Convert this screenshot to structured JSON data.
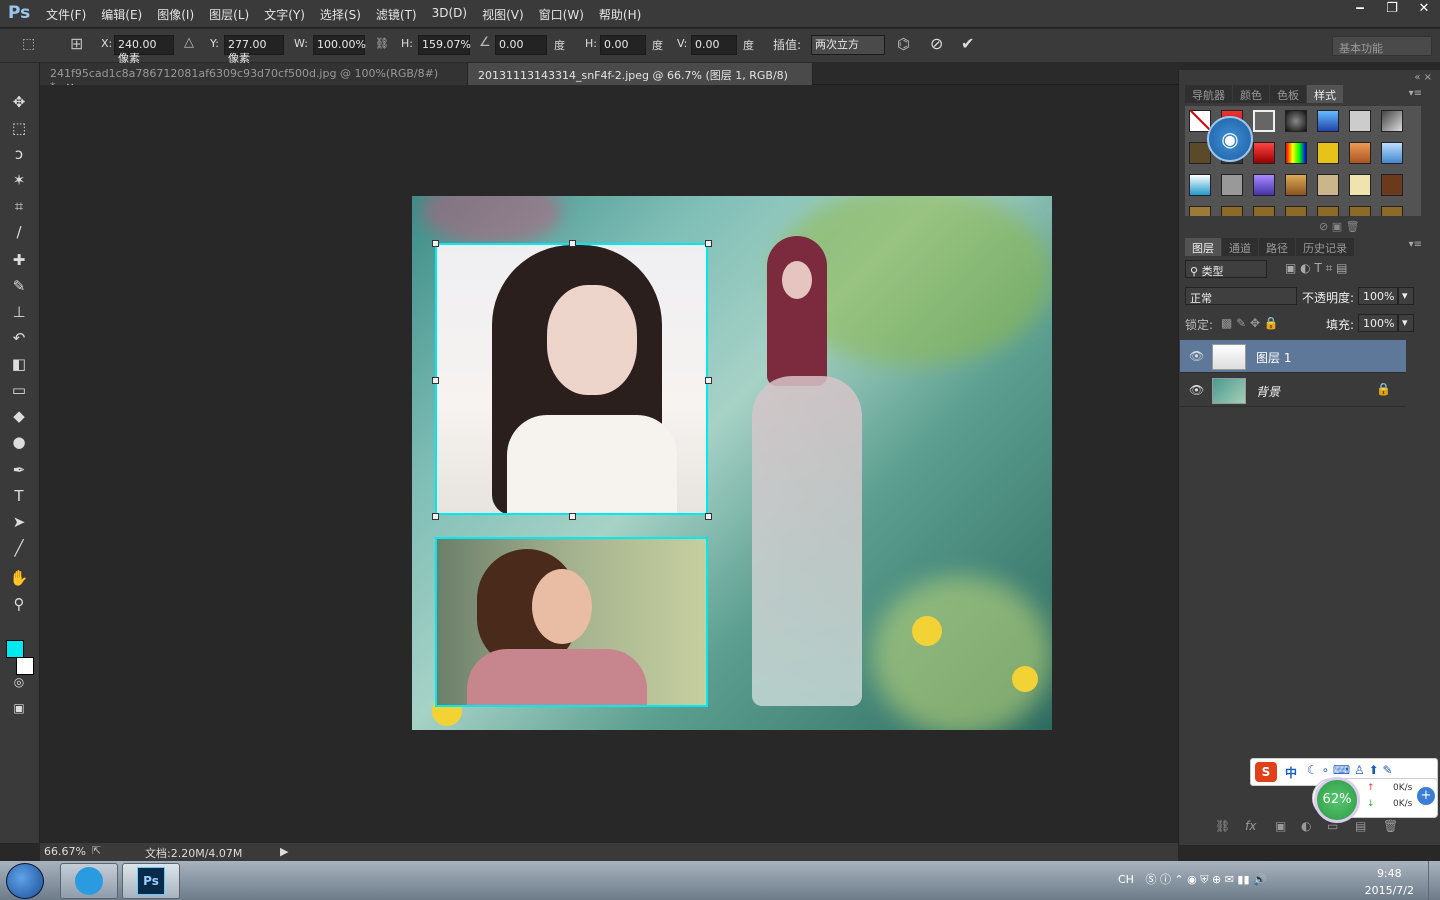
{
  "app": {
    "logo": "Ps"
  },
  "menu": [
    "文件(F)",
    "编辑(E)",
    "图像(I)",
    "图层(L)",
    "文字(Y)",
    "选择(S)",
    "滤镜(T)",
    "3D(D)",
    "视图(V)",
    "窗口(W)",
    "帮助(H)"
  ],
  "options": {
    "x_label": "X:",
    "x_value": "240.00 像素",
    "y_label": "Y:",
    "y_value": "277.00 像素",
    "w_label": "W:",
    "w_value": "100.00%",
    "h_label": "H:",
    "h_value": "159.07%",
    "angle_value": "0.00",
    "angle_unit": "度",
    "hskew_label": "H:",
    "hskew_value": "0.00",
    "hskew_unit": "度",
    "vskew_label": "V:",
    "vskew_value": "0.00",
    "vskew_unit": "度",
    "interp_label": "插值:",
    "interp_value": "两次立方",
    "workspace": "基本功能"
  },
  "tabs": [
    {
      "label": "241f95cad1c8a786712081af6309c93d70cf500d.jpg @ 100%(RGB/8#) *",
      "close": "×"
    },
    {
      "label": "20131113143314_snF4f-2.jpeg @ 66.7% (图层 1, RGB/8) *",
      "close": "×"
    }
  ],
  "status": {
    "zoom": "66.67%",
    "doc": "文档:2.20M/4.07M"
  },
  "panels": {
    "top_tabs": [
      "导航器",
      "颜色",
      "色板",
      "样式"
    ],
    "layer_tabs": [
      "图层",
      "通道",
      "路径",
      "历史记录"
    ],
    "filter": "类型",
    "blend_mode": "正常",
    "opacity_label": "不透明度:",
    "opacity": "100%",
    "lock_label": "锁定:",
    "fill_label": "填充:",
    "fill": "100%"
  },
  "layers": [
    {
      "name": "图层 1",
      "selected": true
    },
    {
      "name": "背景",
      "selected": false
    }
  ],
  "ime": {
    "text": "中"
  },
  "net": {
    "percent": "62%",
    "up": "0K/s",
    "down": "0K/s"
  },
  "tray": {
    "lang": "CH"
  },
  "clock": {
    "time": "9:48",
    "date": "2015/7/2"
  },
  "colors": {
    "foreground": "#00e8f0",
    "background": "#ffffff",
    "selection": "#5d7898"
  }
}
